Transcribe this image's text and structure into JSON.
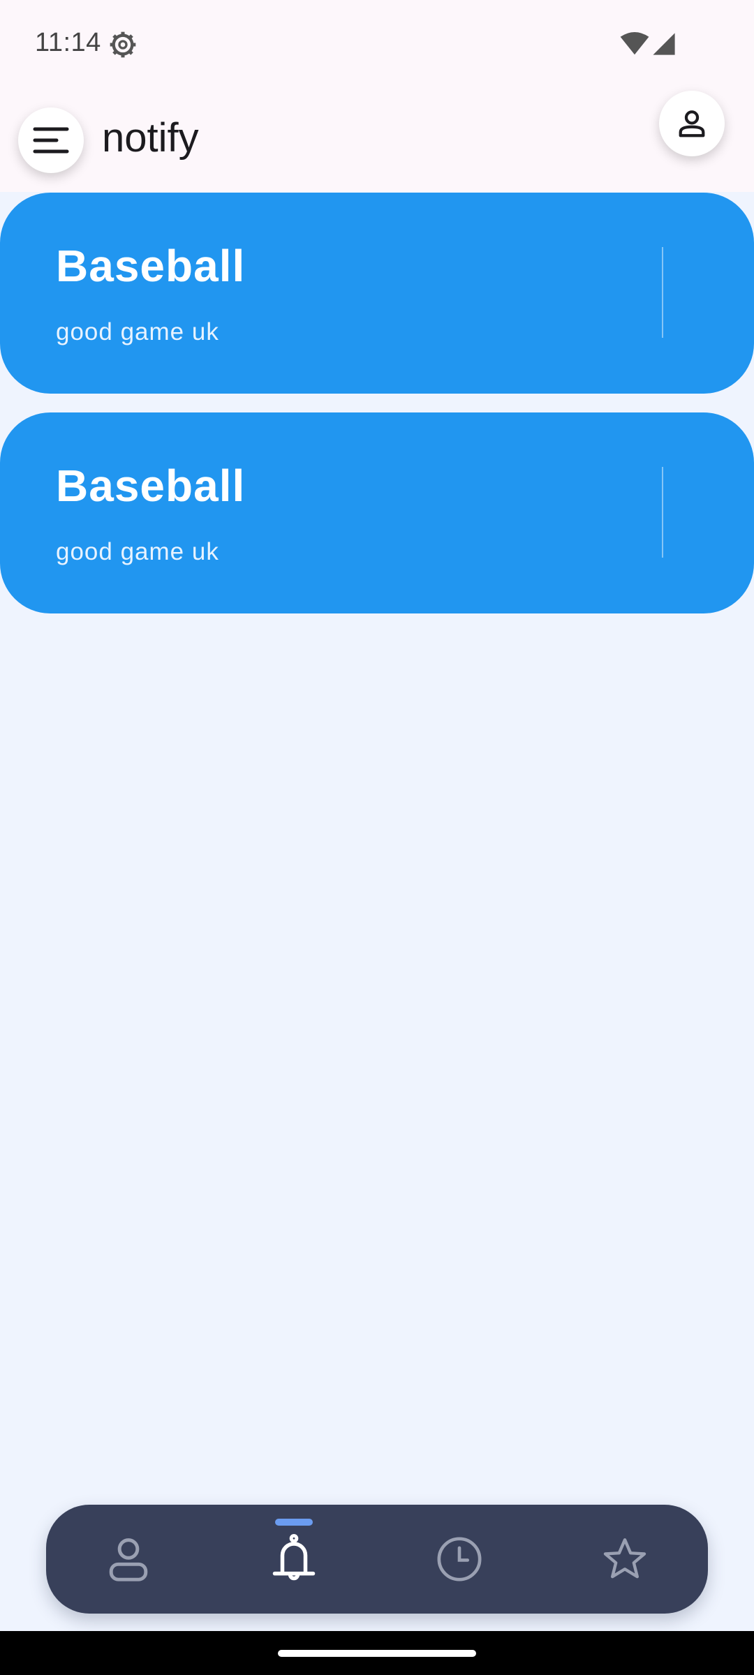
{
  "status_bar": {
    "time": "11:14",
    "icons": [
      "gear-icon",
      "wifi-icon",
      "signal-icon"
    ]
  },
  "app_bar": {
    "title": "notify",
    "menu_icon": "menu-icon",
    "profile_icon": "person-icon"
  },
  "notifications": [
    {
      "title": "Baseball",
      "subtitle": "good game uk"
    },
    {
      "title": "Baseball",
      "subtitle": "good game uk"
    }
  ],
  "bottom_nav": {
    "items": [
      {
        "icon": "person-icon",
        "active": false
      },
      {
        "icon": "bell-icon",
        "active": true
      },
      {
        "icon": "clock-icon",
        "active": false
      },
      {
        "icon": "star-icon",
        "active": false
      }
    ]
  },
  "colors": {
    "card": "#2196f0",
    "background": "#eff4fe",
    "nav_background": "#38405a",
    "nav_indicator": "#6b9cf0"
  }
}
